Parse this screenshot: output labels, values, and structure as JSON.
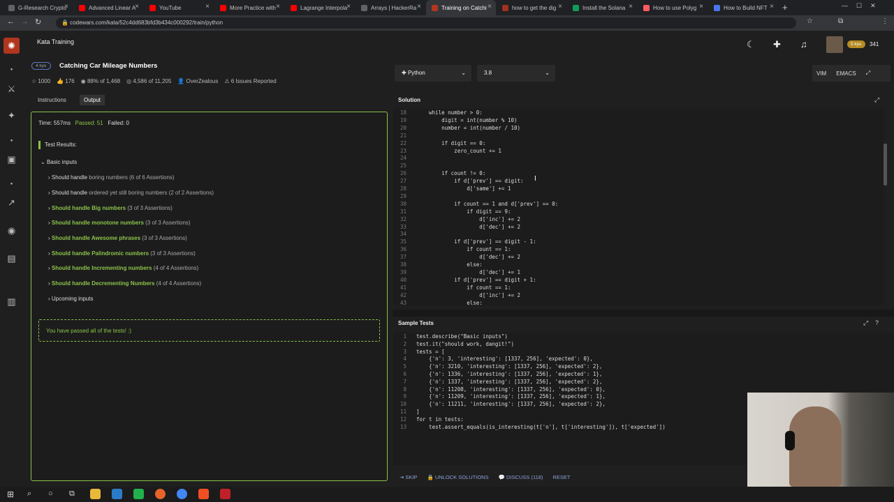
{
  "browser": {
    "tabs": [
      {
        "title": "G-Research Crypto",
        "color": "#5f6368"
      },
      {
        "title": "Advanced Linear A",
        "color": "#ff0000"
      },
      {
        "title": "YouTube",
        "color": "#ff0000"
      },
      {
        "title": "More Practice with",
        "color": "#ff0000"
      },
      {
        "title": "Lagrange Interpola",
        "color": "#ff0000"
      },
      {
        "title": "Arrays | HackerRa",
        "color": "#5f6368"
      },
      {
        "title": "Training on Catchi",
        "color": "#b1361e"
      },
      {
        "title": "how to get the dig",
        "color": "#a03020"
      },
      {
        "title": "Install the Solana",
        "color": "#0f9d58"
      },
      {
        "title": "How to use Polyg",
        "color": "#ff5a5f"
      },
      {
        "title": "How to Build NFT",
        "color": "#4a76e8"
      }
    ],
    "active_tab": 6,
    "url": "codewars.com/kata/52c4dd683bfd3b434c000292/train/python"
  },
  "header": {
    "section": "Kata Training",
    "kyu_badge": "5 kyu",
    "honor": "341"
  },
  "kata": {
    "rank": "4 kyu",
    "title": "Catching Car Mileage Numbers",
    "stats": [
      "1000",
      "176",
      "88% of 1,468",
      "4,586 of 11,205",
      "OverZealous",
      "6 Issues Reported"
    ],
    "tabs": [
      "Instructions",
      "Output"
    ]
  },
  "output": {
    "time": "Time: 557ms",
    "passed": "Passed: 51",
    "failed": "Failed: 0",
    "results_label": "Test Results:",
    "group": "Basic inputs",
    "tests": [
      {
        "name": "Should handle",
        "rest": "boring numbers",
        "count": "(6 of 6 Assertions)",
        "green": false
      },
      {
        "name": "Should handle",
        "rest": "ordered yet still boring numbers",
        "count": "(2 of 2 Assertions)",
        "green": false
      },
      {
        "name": "Should handle Big numbers",
        "rest": "",
        "count": "(3 of 3 Assertions)",
        "green": true
      },
      {
        "name": "Should handle monotone numbers",
        "rest": "",
        "count": "(3 of 3 Assertions)",
        "green": true
      },
      {
        "name": "Should handle Awesome phrases",
        "rest": "",
        "count": "(3 of 3 Assertions)",
        "green": true
      },
      {
        "name": "Should handle Palindromic numbers",
        "rest": "",
        "count": "(3 of 3 Assertions)",
        "green": true
      },
      {
        "name": "Should handle Incrementing numbers",
        "rest": "",
        "count": "(4 of 4 Assertions)",
        "green": true
      },
      {
        "name": "Should handle Decrementing Numbers",
        "rest": "",
        "count": "(4 of 4 Assertions)",
        "green": true
      }
    ],
    "upcoming": "Upcoming inputs",
    "passed_msg": "You have passed all of the tests! :)"
  },
  "editor": {
    "language": "Python",
    "version": "3.8",
    "modes": [
      "VIM",
      "EMACS"
    ],
    "solution_title": "Solution",
    "sample_title": "Sample Tests",
    "solution_lines": [
      [
        "18",
        "    while number > 0:"
      ],
      [
        "19",
        "        digit = int(number % 10)"
      ],
      [
        "20",
        "        number = int(number / 10)"
      ],
      [
        "21",
        ""
      ],
      [
        "22",
        "        if digit == 0:"
      ],
      [
        "23",
        "            zero_count += 1"
      ],
      [
        "24",
        ""
      ],
      [
        "25",
        ""
      ],
      [
        "26",
        "        if count != 0:"
      ],
      [
        "27",
        "            if d['prev'] == digit:"
      ],
      [
        "28",
        "                d['same'] += 1"
      ],
      [
        "29",
        ""
      ],
      [
        "30",
        "            if count == 1 and d['prev'] == 0:"
      ],
      [
        "31",
        "                if digit == 9:"
      ],
      [
        "32",
        "                    d['inc'] += 2"
      ],
      [
        "33",
        "                    d['dec'] += 2"
      ],
      [
        "34",
        ""
      ],
      [
        "35",
        "            if d['prev'] == digit - 1:"
      ],
      [
        "36",
        "                if count == 1:"
      ],
      [
        "37",
        "                    d['dec'] += 2"
      ],
      [
        "38",
        "                else:"
      ],
      [
        "39",
        "                    d['dec'] += 1"
      ],
      [
        "40",
        "            if d['prev'] == digit + 1:"
      ],
      [
        "41",
        "                if count == 1:"
      ],
      [
        "42",
        "                    d['inc'] += 2"
      ],
      [
        "43",
        "                else:"
      ]
    ],
    "sample_lines": [
      [
        "1",
        "test.describe(\"Basic inputs\")"
      ],
      [
        "2",
        "test.it(\"should work, dangit!\")"
      ],
      [
        "3",
        "tests = ["
      ],
      [
        "4",
        "    {'n': 3, 'interesting': [1337, 256], 'expected': 0},"
      ],
      [
        "5",
        "    {'n': 3210, 'interesting': [1337, 256], 'expected': 2},"
      ],
      [
        "6",
        "    {'n': 1336, 'interesting': [1337, 256], 'expected': 1},"
      ],
      [
        "7",
        "    {'n': 1337, 'interesting': [1337, 256], 'expected': 2},"
      ],
      [
        "8",
        "    {'n': 11208, 'interesting': [1337, 256], 'expected': 0},"
      ],
      [
        "9",
        "    {'n': 11209, 'interesting': [1337, 256], 'expected': 1},"
      ],
      [
        "10",
        "    {'n': 11211, 'interesting': [1337, 256], 'expected': 2},"
      ],
      [
        "11",
        "]"
      ],
      [
        "12",
        "for t in tests:"
      ],
      [
        "13",
        "    test.assert_equals(is_interesting(t['n'], t['interesting']), t['expected'])"
      ]
    ],
    "footer": [
      "SKIP",
      "UNLOCK SOLUTIONS",
      "DISCUSS (118)",
      "RESET"
    ]
  }
}
